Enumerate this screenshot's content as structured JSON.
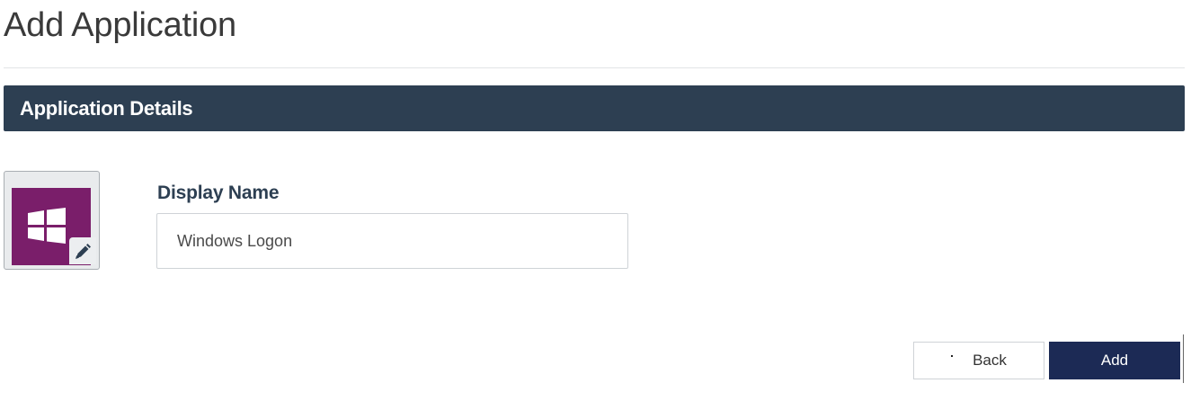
{
  "page": {
    "title": "Add Application"
  },
  "section": {
    "title": "Application Details"
  },
  "app_icon": {
    "icon": "windows-logo-icon",
    "edit_icon": "pencil-icon",
    "tile_color": "#7a1e6a"
  },
  "form": {
    "display_name_label": "Display Name",
    "display_name_value": "Windows Logon"
  },
  "actions": {
    "back_label": "Back",
    "add_label": "Add"
  },
  "colors": {
    "header_bg": "#2d3f52",
    "primary_button": "#1c2a55"
  }
}
